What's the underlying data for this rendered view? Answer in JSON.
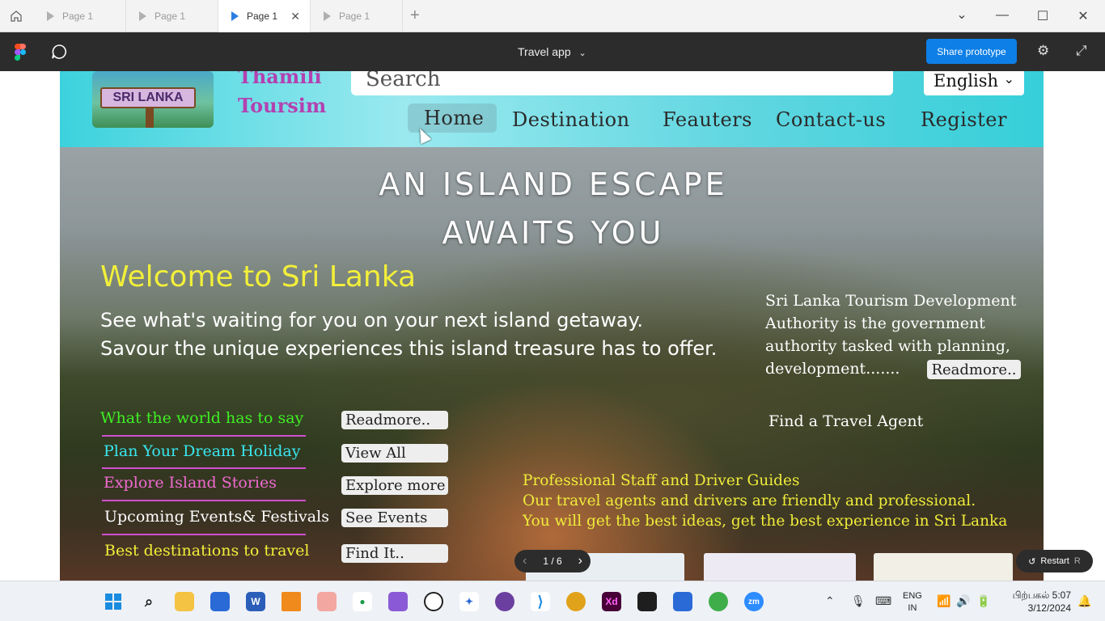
{
  "browser": {
    "tabs": [
      {
        "label": "Page 1",
        "active": false
      },
      {
        "label": "Page 1",
        "active": false
      },
      {
        "label": "Page 1",
        "active": true
      },
      {
        "label": "Page 1",
        "active": false
      }
    ],
    "new_tab": "+",
    "controls": {
      "minimize": "—",
      "maximize": "☐",
      "close": "✕",
      "dropdown": "⌄"
    }
  },
  "toolbar": {
    "project_title": "Travel app",
    "title_chevron": "⌄",
    "share_label": "Share prototype",
    "settings_icon": "⚙",
    "expand_icon": "⤢"
  },
  "site": {
    "logo_text": "SRI LANKA",
    "brand_line1": "Thamili",
    "brand_line2": "Toursim",
    "search_placeholder": "Search",
    "language": "English",
    "nav": [
      "Home",
      "Destination",
      "Feauters",
      "Contact-us",
      "Register"
    ]
  },
  "hero": {
    "headline_line1": "AN ISLAND ESCAPE",
    "headline_line2": "AWAITS YOU",
    "welcome": "Welcome to Sri Lanka",
    "tagline_line1": "See what's waiting for you on your next island getaway.",
    "tagline_line2": "Savour the unique experiences this island treasure has to offer.",
    "sltd_text": "Sri Lanka Tourism Development Authority is the government authority tasked with planning, development.......",
    "sltd_button": "Readmore..",
    "find_agent": "Find a Travel Agent",
    "links": [
      {
        "label": "What the world has to say",
        "button": "Readmore..",
        "color": "#3ff024"
      },
      {
        "label": "Plan Your Dream Holiday",
        "button": "View All",
        "color": "#39e6f0"
      },
      {
        "label": "Explore Island Stories",
        "button": "Explore more",
        "color": "#f06ad0"
      },
      {
        "label": "Upcoming Events& Festivals",
        "button": "See Events",
        "color": "#ffffff"
      },
      {
        "label": "Best destinations to travel",
        "button": "Find It..",
        "color": "#f2ef3a"
      }
    ],
    "pro_line1": "Professional Staff and Driver Guides",
    "pro_line2": "Our travel agents and drivers are friendly and professional.",
    "pro_line3": "You will get the best ideas, get the best experience in Sri Lanka"
  },
  "prototype_controls": {
    "page_indicator": "1 / 6",
    "prev": "‹",
    "next": "›",
    "restart_label": "Restart",
    "restart_key": "R"
  },
  "taskbar": {
    "language_line1": "ENG",
    "language_line2": "IN",
    "time": "பிற்பகல் 5:07",
    "date": "3/12/2024"
  },
  "colors": {
    "accent": "#0d7fe6",
    "toolbar_bg": "#2c2c2c",
    "welcome_yellow": "#f2ef3a",
    "brand_purple": "#b341b0"
  }
}
